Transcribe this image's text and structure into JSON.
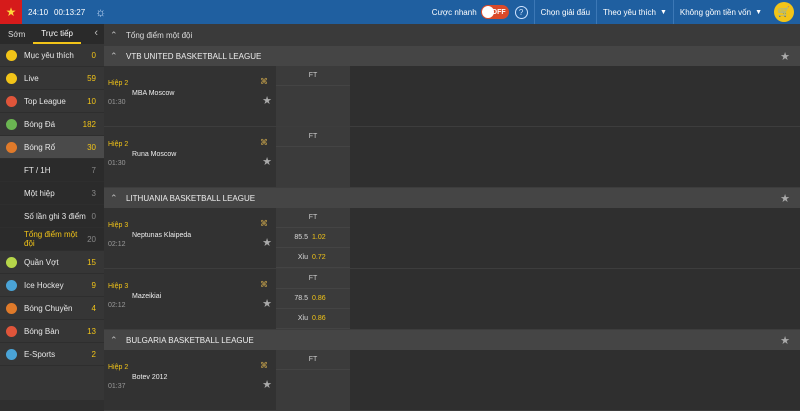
{
  "topbar": {
    "time1": "24:10",
    "time2": "00:13:27",
    "quick_bet": "Cược nhanh",
    "toggle": "OFF",
    "help": "?",
    "choose_league": "Chọn giải đấu",
    "sort": "Theo yêu thích",
    "capital": "Không gồm tiền vốn"
  },
  "sidebar": {
    "tabs": [
      "Sớm",
      "Trực tiếp"
    ],
    "back": "‹",
    "sports": [
      {
        "label": "Mục yêu thích",
        "count": "0",
        "color": "#f2c418",
        "icon": "star-icon"
      },
      {
        "label": "Live",
        "count": "59",
        "color": "#f2c418",
        "icon": "live-icon"
      },
      {
        "label": "Top League",
        "count": "10",
        "color": "#e0553a",
        "icon": "top-league-icon"
      },
      {
        "label": "Bóng Đá",
        "count": "182",
        "color": "#6bb552",
        "icon": "soccer-icon"
      },
      {
        "label": "Bóng Rổ",
        "count": "30",
        "color": "#e07a2a",
        "icon": "basketball-icon"
      }
    ],
    "sub_items": [
      {
        "label": "FT / 1H",
        "count": "7"
      },
      {
        "label": "Một hiệp",
        "count": "3"
      },
      {
        "label": "Số lần ghi 3 điểm",
        "count": "0"
      },
      {
        "label": "Tổng điểm một đội",
        "count": "20"
      }
    ],
    "sports2": [
      {
        "label": "Quần Vợt",
        "count": "15",
        "color": "#b6d64a",
        "icon": "tennis-icon"
      },
      {
        "label": "Ice Hockey",
        "count": "9",
        "color": "#4aa3d6",
        "icon": "ice-hockey-icon"
      },
      {
        "label": "Bóng Chuyền",
        "count": "4",
        "color": "#e07a2a",
        "icon": "volleyball-icon"
      },
      {
        "label": "Bóng Bàn",
        "count": "13",
        "color": "#e0553a",
        "icon": "table-tennis-icon"
      },
      {
        "label": "E-Sports",
        "count": "2",
        "color": "#4aa3d6",
        "icon": "esports-icon"
      }
    ]
  },
  "main": {
    "header": "Tổng điểm một đội",
    "leagues": [
      {
        "name": "VTB UNITED BASKETBALL LEAGUE",
        "matches": [
          {
            "period": "Hiệp 2",
            "time": "01:30",
            "team": "MBA Moscow",
            "head": "FT",
            "lines": []
          },
          {
            "period": "Hiệp 2",
            "time": "01:30",
            "team": "Runa Moscow",
            "head": "FT",
            "lines": []
          }
        ]
      },
      {
        "name": "LITHUANIA BASKETBALL LEAGUE",
        "matches": [
          {
            "period": "Hiệp 3",
            "time": "02:12",
            "team": "Neptunas Klaipeda",
            "head": "FT",
            "lines": [
              {
                "line": "85.5",
                "odd": "1.02"
              },
              {
                "line": "Xỉu",
                "odd": "0.72"
              }
            ]
          },
          {
            "period": "Hiệp 3",
            "time": "02:12",
            "team": "Mazeikiai",
            "head": "FT",
            "lines": [
              {
                "line": "78.5",
                "odd": "0.86"
              },
              {
                "line": "Xỉu",
                "odd": "0.86"
              }
            ]
          }
        ]
      },
      {
        "name": "BULGARIA BASKETBALL LEAGUE",
        "matches": [
          {
            "period": "Hiệp 2",
            "time": "01:37",
            "team": "Botev 2012",
            "head": "FT",
            "lines": []
          }
        ]
      }
    ]
  }
}
